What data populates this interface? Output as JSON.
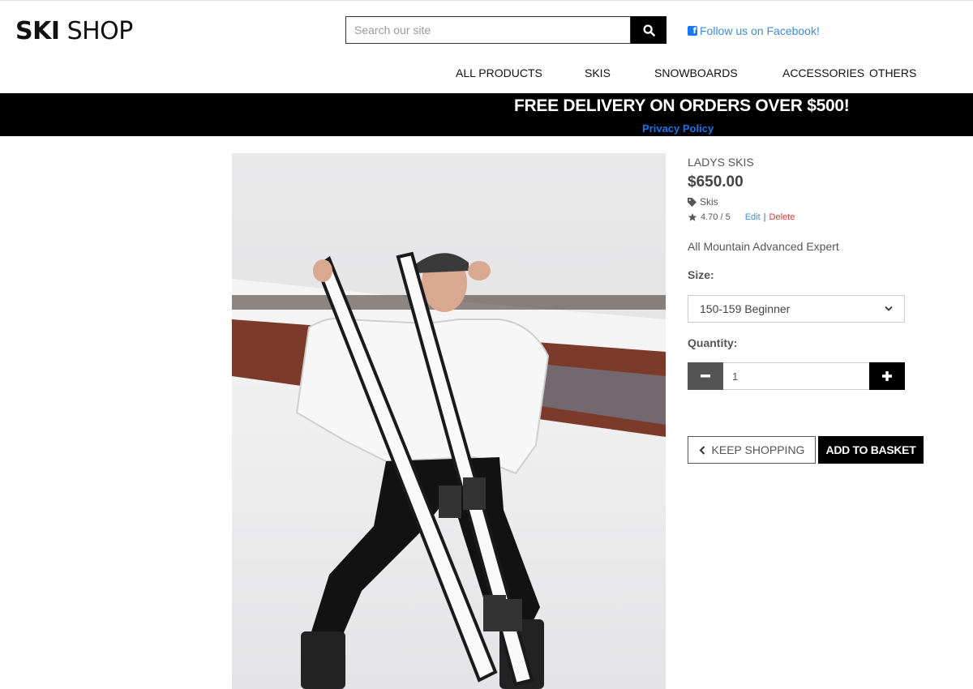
{
  "header": {
    "logo_bold": "SKI",
    "logo_light": "SHOP",
    "search_placeholder": "Search our site",
    "search_icon": "search-icon",
    "facebook_icon": "facebook-icon",
    "facebook_label": "Follow us on Facebook!"
  },
  "nav": {
    "items": [
      {
        "label": "ALL PRODUCTS"
      },
      {
        "label": "SKIS"
      },
      {
        "label": "SNOWBOARDS"
      },
      {
        "label": "ACCESSORIES"
      },
      {
        "label": "OTHERS"
      }
    ]
  },
  "banner": {
    "text": "FREE DELIVERY ON ORDERS OVER $500!",
    "link": "Privacy Policy"
  },
  "product": {
    "name": "LADYS SKIS",
    "price": "$650.00",
    "category": "Skis",
    "category_icon": "tag-icon",
    "rating": "4.70 / 5",
    "rating_icon": "star-icon",
    "edit": "Edit",
    "separator": "|",
    "delete": "Delete",
    "description": "All Mountain Advanced Expert",
    "size_label": "Size:",
    "size_selected": "150-159 Beginner",
    "quantity_label": "Quantity:",
    "quantity_value": "1",
    "keep_shopping": "KEEP SHOPPING",
    "add_to_basket": "ADD TO BASKET"
  },
  "colors": {
    "accent_blue": "#3b8ed9",
    "delete_red": "#e3342f",
    "banner_bg": "#000000",
    "privacy_link": "#1a73e8"
  }
}
